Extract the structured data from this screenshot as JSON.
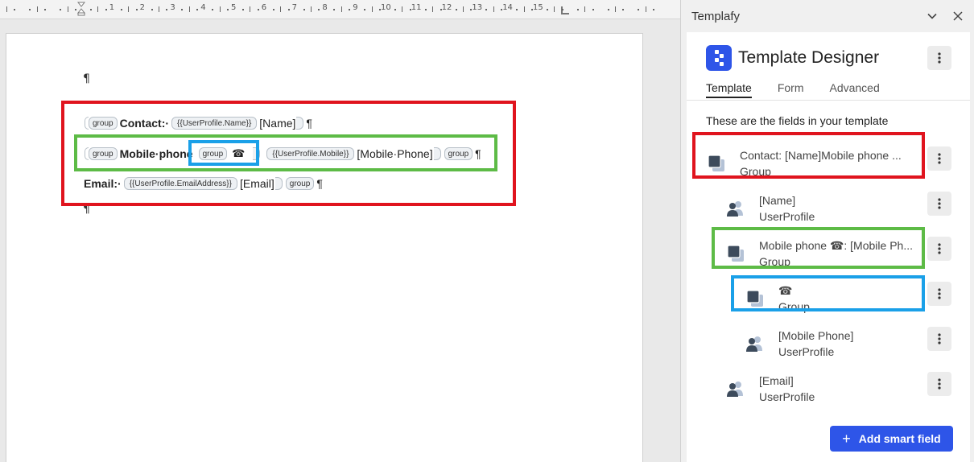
{
  "document": {
    "pilcrow": "¶",
    "line1": {
      "group_tag": "group",
      "label": "Contact:·",
      "field_tag": "{{UserProfile.Name}}",
      "value": "[Name]",
      "end": "¶"
    },
    "line2": {
      "group_tag": "group",
      "label": "Mobile·phone",
      "inner_group_tag": "group",
      "phone_glyph": "☎",
      "field_tag": "{{UserProfile.Mobile}}",
      "value": "[Mobile·Phone]",
      "closing_group_tag": "group",
      "end": "¶"
    },
    "line3": {
      "label": "Email:·",
      "field_tag": "{{UserProfile.EmailAddress}}",
      "value": "[Email]",
      "closing_group_tag": "group",
      "end": "¶"
    },
    "ruler_numbers": [
      "1",
      "2",
      "3",
      "4",
      "5",
      "6",
      "7",
      "8",
      "9",
      "10",
      "11",
      "12",
      "13",
      "14",
      "15"
    ]
  },
  "pane": {
    "title": "Templafy",
    "collapse_icon": "chevron-down-icon",
    "close_icon": "close-icon",
    "designer_title": "Template Designer",
    "tabs": [
      {
        "label": "Template",
        "active": true
      },
      {
        "label": "Form",
        "active": false
      },
      {
        "label": "Advanced",
        "active": false
      }
    ],
    "section_label": "These are the fields in your template",
    "fields": [
      {
        "title": "Contact: [Name]Mobile phone ...",
        "type": "Group",
        "icon": "group-icon"
      },
      {
        "title": "[Name]",
        "type": "UserProfile",
        "icon": "user-profile-icon"
      },
      {
        "title": "Mobile phone ☎: [Mobile Ph...",
        "type": "Group",
        "icon": "group-icon"
      },
      {
        "title": "☎",
        "type": "Group",
        "icon": "group-icon"
      },
      {
        "title": "[Mobile Phone]",
        "type": "UserProfile",
        "icon": "user-profile-icon"
      },
      {
        "title": "[Email]",
        "type": "UserProfile",
        "icon": "user-profile-icon"
      }
    ],
    "add_button": {
      "plus": "+",
      "label": "Add smart field"
    }
  },
  "colors": {
    "accent": "#2e55e8",
    "highlight_red": "#e0141e",
    "highlight_green": "#5dbb46",
    "highlight_blue": "#1aa0e8",
    "icon_dark": "#3d4b5c",
    "icon_light": "#b4c2d6"
  }
}
